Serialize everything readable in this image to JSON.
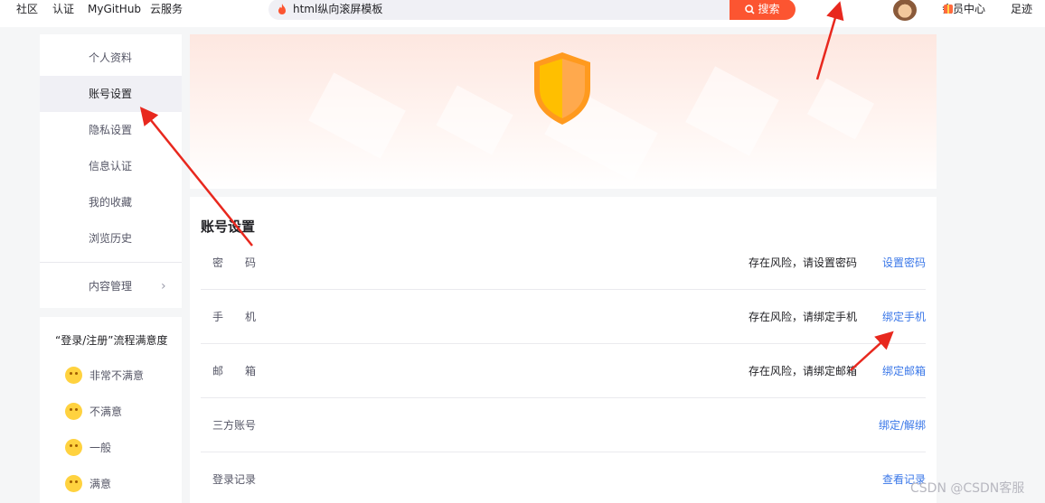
{
  "topnav": {
    "left_items": [
      "社区",
      "认证",
      "MyGitHub",
      "云服务"
    ],
    "search_query": "html纵向滚屏模板",
    "search_button": "搜索",
    "member_center": "会员中心",
    "footprint": "足迹"
  },
  "sidebar": {
    "items": [
      {
        "label": "个人资料"
      },
      {
        "label": "账号设置",
        "active": true
      },
      {
        "label": "隐私设置"
      },
      {
        "label": "信息认证"
      },
      {
        "label": "我的收藏"
      },
      {
        "label": "浏览历史"
      }
    ],
    "content_manage": "内容管理"
  },
  "survey": {
    "title": "“登录/注册”流程满意度",
    "options": [
      "非常不满意",
      "不满意",
      "一般",
      "满意"
    ]
  },
  "account": {
    "title": "账号设置",
    "rows": [
      {
        "label": "密　　码",
        "status": "存在风险，请设置密码",
        "action": "设置密码"
      },
      {
        "label": "手　　机",
        "status": "存在风险，请绑定手机",
        "action": "绑定手机"
      },
      {
        "label": "邮　　箱",
        "status": "存在风险，请绑定邮箱",
        "action": "绑定邮箱"
      },
      {
        "label": "三方账号",
        "status": "",
        "action": "绑定/解绑"
      },
      {
        "label": "登录记录",
        "status": "",
        "action": "查看记录"
      }
    ]
  },
  "watermark": "CSDN @CSDN客服",
  "colors": {
    "brand": "#fc5531",
    "link": "#3a77e8",
    "annotation_arrow": "#e8281e",
    "shield_left": "#ffb300",
    "shield_right": "#ff9a3c"
  },
  "icons": [
    "flame-icon",
    "search-icon",
    "avatar",
    "gift-icon",
    "chevron-right-icon",
    "shield-icon",
    "face-very-unsatisfied-icon",
    "face-unsatisfied-icon",
    "face-neutral-icon",
    "face-satisfied-icon"
  ]
}
